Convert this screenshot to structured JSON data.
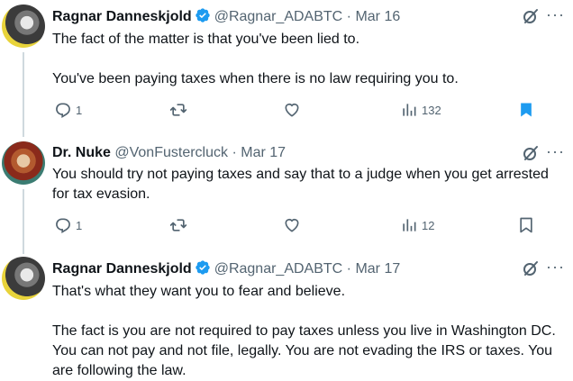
{
  "tweets": [
    {
      "name": "Ragnar Danneskjold",
      "handle": "@Ragnar_ADABTC",
      "date": "Mar 16",
      "lines": [
        "The fact of the matter is that you've been lied to.",
        "You've been paying taxes when there is no law requiring you to."
      ],
      "replies": "1",
      "retweets": "",
      "likes": "",
      "views": "132",
      "bookmarked": true,
      "verified": true
    },
    {
      "name": "Dr. Nuke",
      "handle": "@VonFustercluck",
      "date": "Mar 17",
      "lines": [
        "You should try not paying taxes and say that to a judge when you get arrested for tax evasion."
      ],
      "replies": "1",
      "retweets": "",
      "likes": "",
      "views": "12",
      "bookmarked": false,
      "verified": false
    },
    {
      "name": "Ragnar Danneskjold",
      "handle": "@Ragnar_ADABTC",
      "date": "Mar 17",
      "lines": [
        "That's what they want you to fear and believe.",
        "The fact is you are not required to pay taxes unless you live in Washington DC. You can not pay and not file, legally. You are not evading the IRS or taxes. You are following the law."
      ],
      "verified": true
    }
  ],
  "separator": "·",
  "colors": {
    "muted": "#536471",
    "text": "#0f1419",
    "verified": "#1d9bf0",
    "bookmark_active": "#1d9bf0"
  },
  "icons": [
    "reply-icon",
    "retweet-icon",
    "like-icon",
    "views-icon",
    "bookmark-icon",
    "grok-icon",
    "more-icon",
    "verified-icon"
  ]
}
